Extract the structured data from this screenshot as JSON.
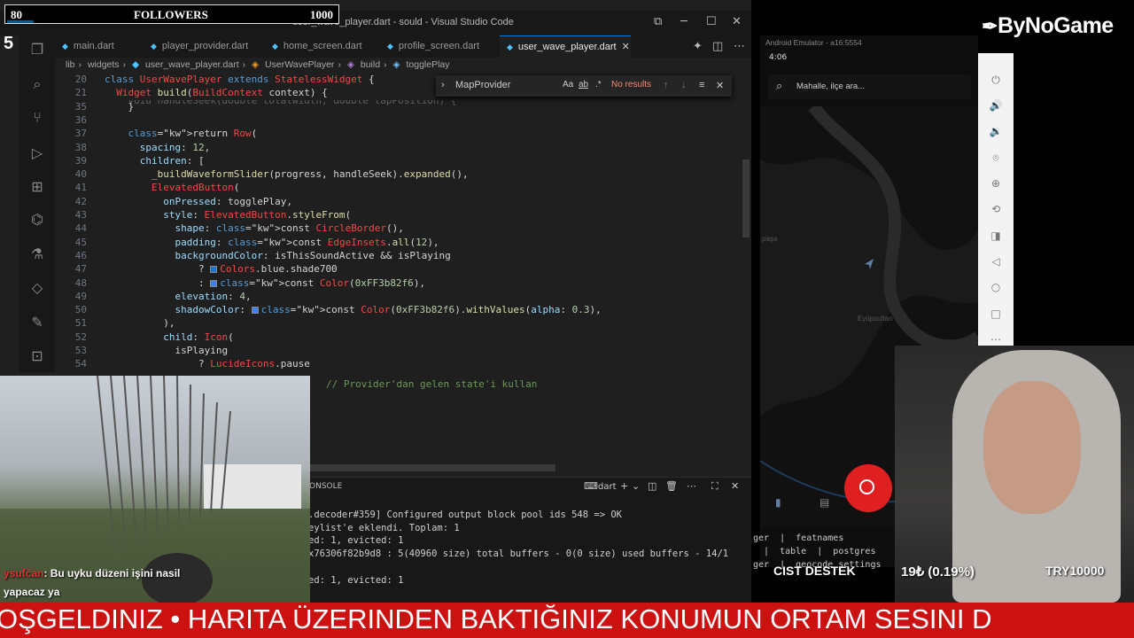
{
  "followers": {
    "current": "80",
    "label": "FOLLOWERS",
    "goal": "1000",
    "progress_fraction": 0.08
  },
  "overlay_number": "5",
  "vscode": {
    "window_title": "user_wave_player.dart - sould - Visual Studio Code",
    "tabs": [
      "main.dart",
      "player_provider.dart",
      "home_screen.dart",
      "profile_screen.dart",
      "user_wave_player.dart"
    ],
    "active_tab": "user_wave_player.dart",
    "breadcrumb": [
      "lib",
      "widgets",
      "user_wave_player.dart",
      "UserWavePlayer",
      "build",
      "togglePlay"
    ],
    "find": {
      "query": "MapProvider",
      "result": "No results"
    },
    "lines": [
      {
        "n": "20",
        "t": "class UserWavePlayer extends StatelessWidget {"
      },
      {
        "n": "21",
        "t": "  Widget build(BuildContext context) {"
      },
      {
        "n": "35",
        "t": "    }"
      },
      {
        "n": "36",
        "t": ""
      },
      {
        "n": "37",
        "t": "    return Row("
      },
      {
        "n": "38",
        "t": "      spacing: 12,"
      },
      {
        "n": "39",
        "t": "      children: ["
      },
      {
        "n": "40",
        "t": "        _buildWaveformSlider(progress, handleSeek).expanded(),"
      },
      {
        "n": "41",
        "t": "        ElevatedButton("
      },
      {
        "n": "42",
        "t": "          onPressed: togglePlay,"
      },
      {
        "n": "43",
        "t": "          style: ElevatedButton.styleFrom("
      },
      {
        "n": "44",
        "t": "            shape: const CircleBorder(),"
      },
      {
        "n": "45",
        "t": "            padding: const EdgeInsets.all(12),"
      },
      {
        "n": "46",
        "t": "            backgroundColor: isThisSoundActive && isPlaying"
      },
      {
        "n": "47",
        "t": "                ? Colors.blue.shade700"
      },
      {
        "n": "48",
        "t": "                : const Color(0xFF3b82f6),"
      },
      {
        "n": "49",
        "t": "            elevation: 4,"
      },
      {
        "n": "50",
        "t": "            shadowColor: const Color(0xFF3b82f6).withValues(alpha: 0.3),"
      },
      {
        "n": "51",
        "t": "          ),"
      },
      {
        "n": "52",
        "t": "          child: Icon("
      },
      {
        "n": "53",
        "t": "            isPlaying"
      },
      {
        "n": "54",
        "t": "                ? LucideIcons.pause"
      }
    ],
    "hidden_line_35": "void handleSeek(double totalWidth, double tapPosition) {",
    "comment_line": "// Provider'dan gelen state'i kullan",
    "panel": {
      "tab_label": "ONSOLE",
      "lang": "dart",
      "output": [
        ".decoder#359] Configured output block pool ids 548 => OK",
        "eylist'e eklendi. Toplam: 1",
        "ed: 1, evicted: 1",
        "x76306f82b9d8 : 5(40960 size) total buffers - 0(0 size) used buffers - 14/1",
        "",
        "ed: 1, evicted: 1"
      ]
    }
  },
  "emulator": {
    "title": "Android Emulator - a16:5554",
    "time": "4:06",
    "search_placeholder": "Mahalle, ilçe ara...",
    "map_labels": [
      "Eyüpsultan",
      "paşa"
    ]
  },
  "logo": "ByNoGame",
  "side_text": [
    "ger  |  featnames",
    "  |  table  |  postgres",
    "ger  |  geocode_settings"
  ],
  "chat": {
    "user": "ysufcan",
    "message": ": Bu uyku düzeni işini nasil",
    "message2": "yapacaz ya"
  },
  "donation": {
    "label": "CIST DESTEK",
    "amount": "19₺ (0.19%)",
    "goal": "TRY10000"
  },
  "ticker": "OŞGELDINIZ • HARITA ÜZERINDEN BAKTIĞINIZ KONUMUN ORTAM SESINI D",
  "colors": {
    "ticker": "#cc1111",
    "record": "#e02020",
    "accent": "#0078d4"
  }
}
